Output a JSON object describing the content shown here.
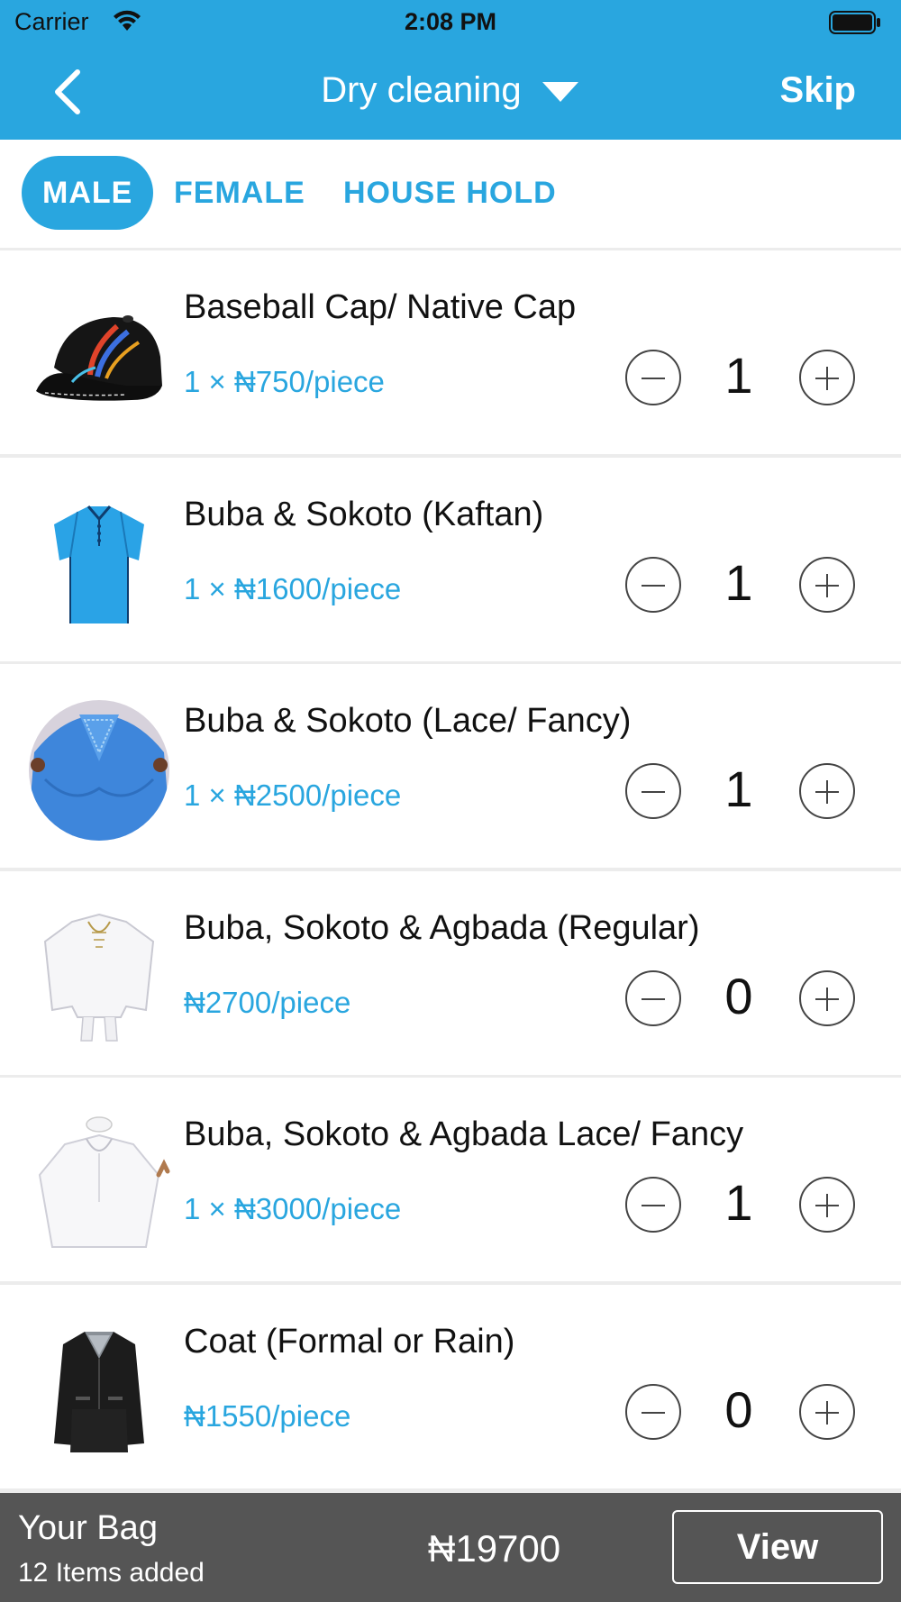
{
  "status": {
    "carrier": "Carrier",
    "time": "2:08 PM"
  },
  "nav": {
    "title": "Dry cleaning",
    "skip": "Skip"
  },
  "tabs": [
    {
      "label": "MALE",
      "active": true
    },
    {
      "label": "FEMALE",
      "active": false
    },
    {
      "label": "HOUSE HOLD",
      "active": false
    }
  ],
  "items": [
    {
      "name": "Baseball Cap/ Native Cap",
      "price": "1 × ₦750/piece",
      "qty": "1",
      "image": "cap-image"
    },
    {
      "name": "Buba & Sokoto (Kaftan)",
      "price": "1 × ₦1600/piece",
      "qty": "1",
      "image": "kaftan-image"
    },
    {
      "name": "Buba & Sokoto (Lace/ Fancy)",
      "price": "1 × ₦2500/piece",
      "qty": "1",
      "image": "lace-image"
    },
    {
      "name": "Buba, Sokoto & Agbada (Regular)",
      "price": "₦2700/piece",
      "qty": "0",
      "image": "agbada-image"
    },
    {
      "name": "Buba, Sokoto & Agbada Lace/ Fancy",
      "price": "1 × ₦3000/piece",
      "qty": "1",
      "image": "agbada-lace-image"
    },
    {
      "name": "Coat (Formal or Rain)",
      "price": "₦1550/piece",
      "qty": "0",
      "image": "coat-image"
    }
  ],
  "bag": {
    "label": "Your Bag",
    "count": "12 Items added",
    "total": "₦19700",
    "view": "View"
  },
  "colors": {
    "accent": "#29a6df",
    "bag_bar": "#555555"
  }
}
